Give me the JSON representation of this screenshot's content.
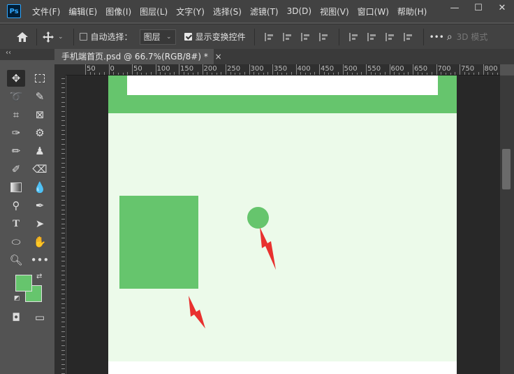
{
  "app": {
    "logo": "Ps"
  },
  "menu": [
    "文件(F)",
    "编辑(E)",
    "图像(I)",
    "图层(L)",
    "文字(Y)",
    "选择(S)",
    "滤镜(T)",
    "3D(D)",
    "视图(V)",
    "窗口(W)",
    "帮助(H)"
  ],
  "window_controls": {
    "minimize": "—",
    "maximize": "☐",
    "close": "✕"
  },
  "options": {
    "home_icon": "home-icon",
    "move_icon": "move-icon",
    "auto_select_label": "自动选择：",
    "auto_select_checked": false,
    "layer_select_value": "图层",
    "show_transform_label": "显示变换控件",
    "show_transform_checked": true,
    "mode_3d_label": "3D 模式"
  },
  "panel_collapse": "‹‹",
  "document": {
    "tab_title": "手机端首页.psd @ 66.7%(RGB/8#) *",
    "close": "×"
  },
  "ruler": {
    "horizontal_labels": [
      "50",
      "0",
      "50",
      "100",
      "150",
      "200",
      "250",
      "300",
      "350",
      "400",
      "450",
      "500",
      "550",
      "600",
      "650",
      "700",
      "750",
      "800"
    ]
  },
  "colors": {
    "foreground": "#66c56d",
    "background": "#66c56d",
    "canvas_bg": "#ecfaea",
    "annotation_arrow": "#e8312f"
  }
}
